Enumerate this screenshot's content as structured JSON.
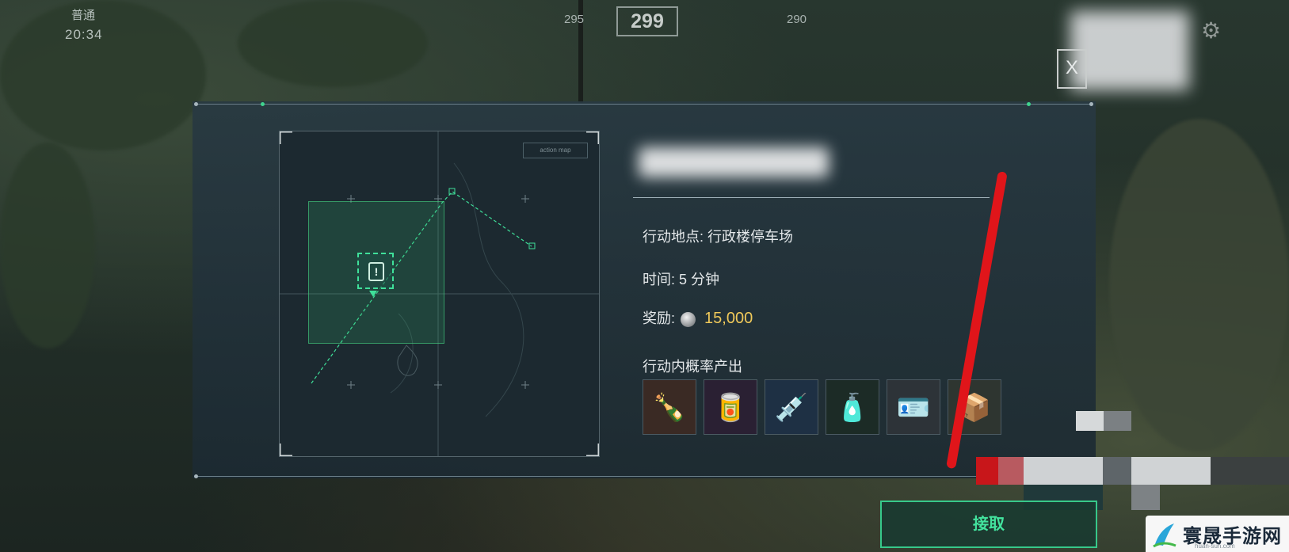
{
  "hud": {
    "mode": "普通",
    "time": "20:34",
    "left_count": "295",
    "center_count": "299",
    "right_count": "290"
  },
  "top_right": {
    "close_label": "X",
    "gear_icon": "gear-icon"
  },
  "map": {
    "tag": "action map"
  },
  "mission": {
    "location_label": "行动地点:",
    "location_value": "行政楼停车场",
    "time_label": "时间:",
    "time_value": "5 分钟",
    "reward_label": "奖励:",
    "reward_value": "15,000",
    "loot_title": "行动内概率产出",
    "loot_items": [
      {
        "icon": "drink-bottle-icon",
        "glyph": "🍾"
      },
      {
        "icon": "can-icon",
        "glyph": "🥫"
      },
      {
        "icon": "syringe-icon",
        "glyph": "💉"
      },
      {
        "icon": "medicine-pack-icon",
        "glyph": "🧴"
      },
      {
        "icon": "id-card-icon",
        "glyph": "🪪"
      },
      {
        "icon": "card-pack-icon",
        "glyph": "📦"
      }
    ]
  },
  "actions": {
    "accept_label": "接取"
  },
  "watermark": {
    "name": "寰晟手游网",
    "url": "huan-sun.com"
  },
  "colors": {
    "accent_green": "#3fe09a",
    "reward_gold": "#f0c95a",
    "annotation_red": "#e0151a"
  }
}
